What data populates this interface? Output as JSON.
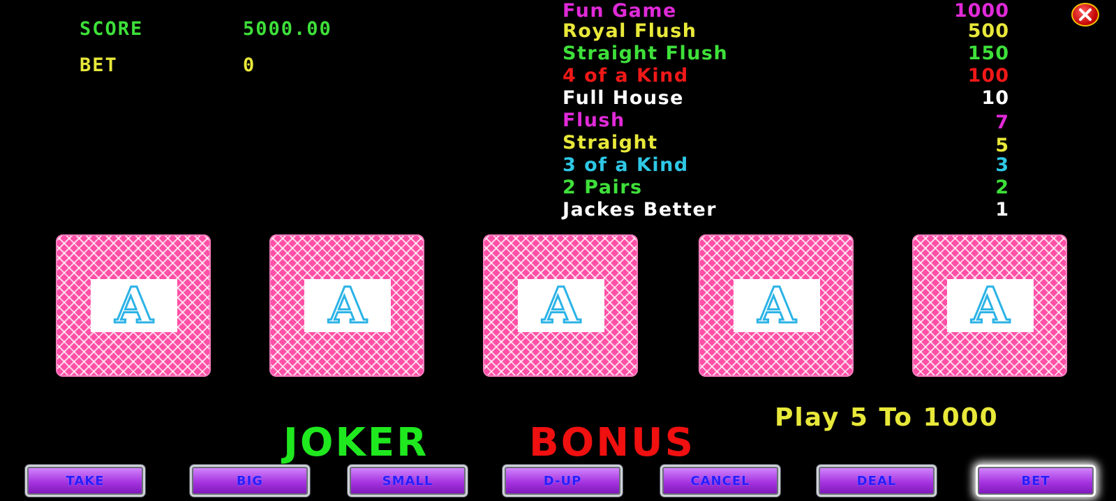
{
  "stats": {
    "score_label": "SCORE",
    "score_value": "5000.00",
    "bet_label": "BET",
    "bet_value": "0"
  },
  "paytable": [
    {
      "name": "Fun Game",
      "value": "1000",
      "color": "#e02ad8"
    },
    {
      "name": "Royal Flush",
      "value": "500",
      "color": "#e8e83a"
    },
    {
      "name": "Straight Flush",
      "value": "150",
      "color": "#3ee03a"
    },
    {
      "name": "4 of a Kind",
      "value": "100",
      "color": "#f01818"
    },
    {
      "name": "Full House",
      "value": "10",
      "color": "#ffffff"
    },
    {
      "name": "Flush",
      "value": "7",
      "color": "#e02ad8"
    },
    {
      "name": "Straight",
      "value": "5",
      "color": "#e8e83a"
    },
    {
      "name": "3 of a Kind",
      "value": "3",
      "color": "#2ec8e6"
    },
    {
      "name": "2 Pairs",
      "value": "2",
      "color": "#3ee03a"
    },
    {
      "name": "Jackes Better",
      "value": "1",
      "color": "#ffffff"
    }
  ],
  "cards": [
    {
      "letter": "A"
    },
    {
      "letter": "A"
    },
    {
      "letter": "A"
    },
    {
      "letter": "A"
    },
    {
      "letter": "A"
    }
  ],
  "title": {
    "word1": "JOKER",
    "word2": "BONUS",
    "word1_color": "#1fe81f",
    "word2_color": "#f01010"
  },
  "play_range": "Play 5 To 1000",
  "buttons": {
    "take": "TAKE",
    "big": "BIG",
    "small": "SMALL",
    "dup": "D-UP",
    "cancel": "CANCEL",
    "deal": "DEAL",
    "bet": "BET"
  },
  "close_icon": "close-icon"
}
